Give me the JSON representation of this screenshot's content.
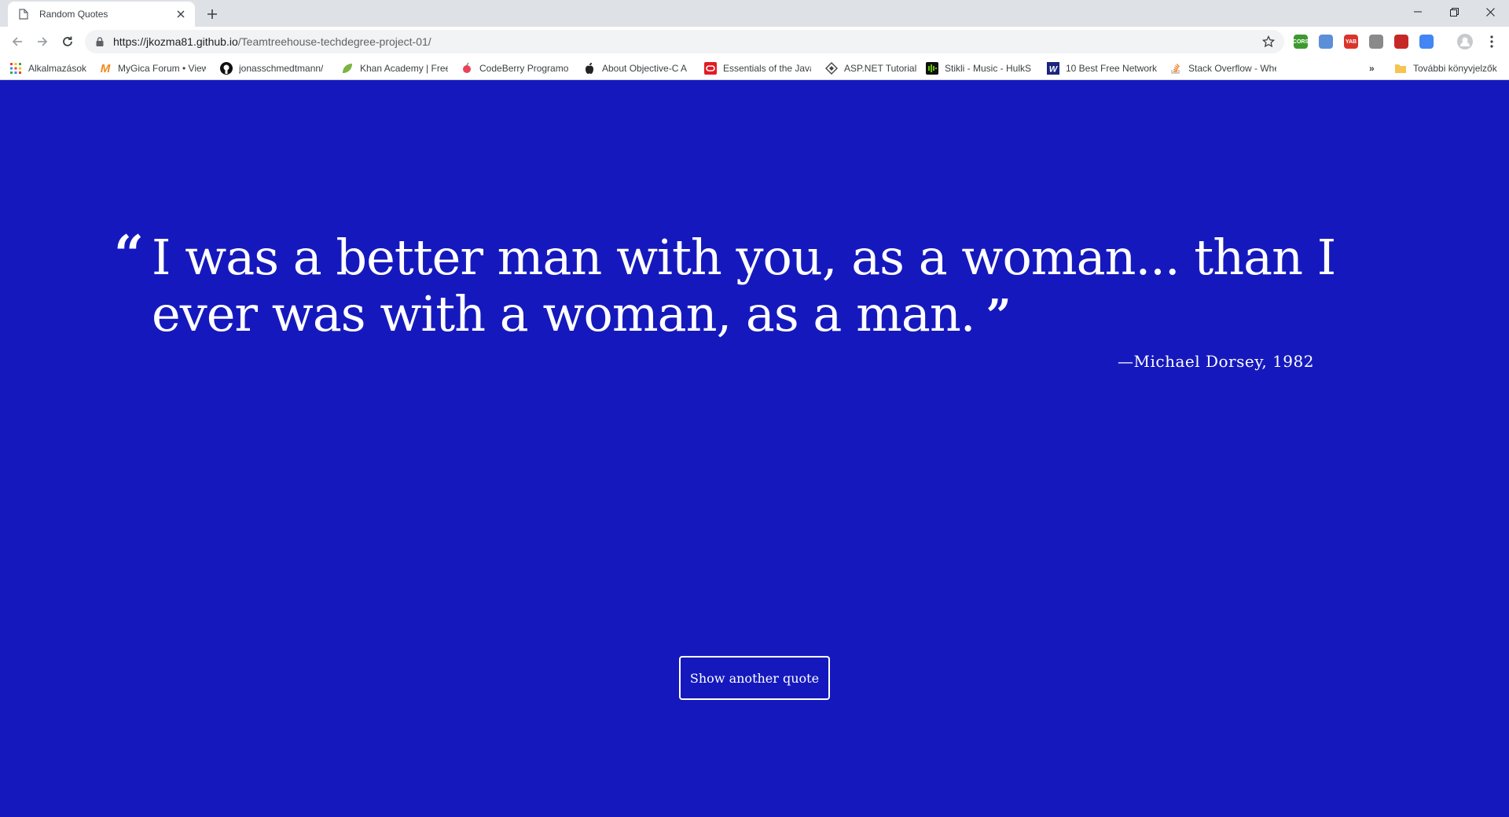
{
  "browser": {
    "tab_title": "Random Quotes",
    "url_host": "https://jkozma81.github.io",
    "url_path": "/Teamtreehouse-techdegree-project-01/",
    "extensions": [
      {
        "name": "cors-extension-icon",
        "text": "CORS",
        "color": "#3c9a2e"
      },
      {
        "name": "blue-extension-icon",
        "text": "",
        "color": "#5b8fd8"
      },
      {
        "name": "yab-extension-icon",
        "text": "YAB",
        "color": "#d9352b"
      },
      {
        "name": "gray-extension-icon",
        "text": "",
        "color": "#8a8a8a"
      },
      {
        "name": "ruby-extension-icon",
        "text": "",
        "color": "#c62828"
      },
      {
        "name": "eyedropper-extension-icon",
        "text": "",
        "color": "#4285f4"
      }
    ]
  },
  "bookmarks": {
    "items": [
      {
        "label": "Alkalmazások",
        "icon": "apps-grid-icon"
      },
      {
        "label": "MyGica Forum • View",
        "icon": "mygica-icon"
      },
      {
        "label": "jonasschmedtmann/",
        "icon": "github-icon"
      },
      {
        "label": "Khan Academy | Free",
        "icon": "khan-academy-icon"
      },
      {
        "label": "CodeBerry Programo",
        "icon": "codeberry-icon"
      },
      {
        "label": "About Objective-C A",
        "icon": "apple-icon"
      },
      {
        "label": "Essentials of the Java",
        "icon": "oracle-icon"
      },
      {
        "label": "ASP.NET Tutorial",
        "icon": "aspnet-icon"
      },
      {
        "label": "Stikli - Music - HulkS",
        "icon": "stikli-icon"
      },
      {
        "label": "10 Best Free Network",
        "icon": "w-icon"
      },
      {
        "label": "Stack Overflow - Whe",
        "icon": "stack-overflow-icon"
      }
    ],
    "overflow": "»",
    "other_folder": "További könyvjelzők"
  },
  "page": {
    "quote": "I was a better man with you, as a woman... than I ever was with a woman, as a man.",
    "open_mark": "“",
    "close_mark": "”",
    "source": "—Michael Dorsey, 1982",
    "button_label": "Show another quote",
    "background_color": "#1519bd"
  }
}
